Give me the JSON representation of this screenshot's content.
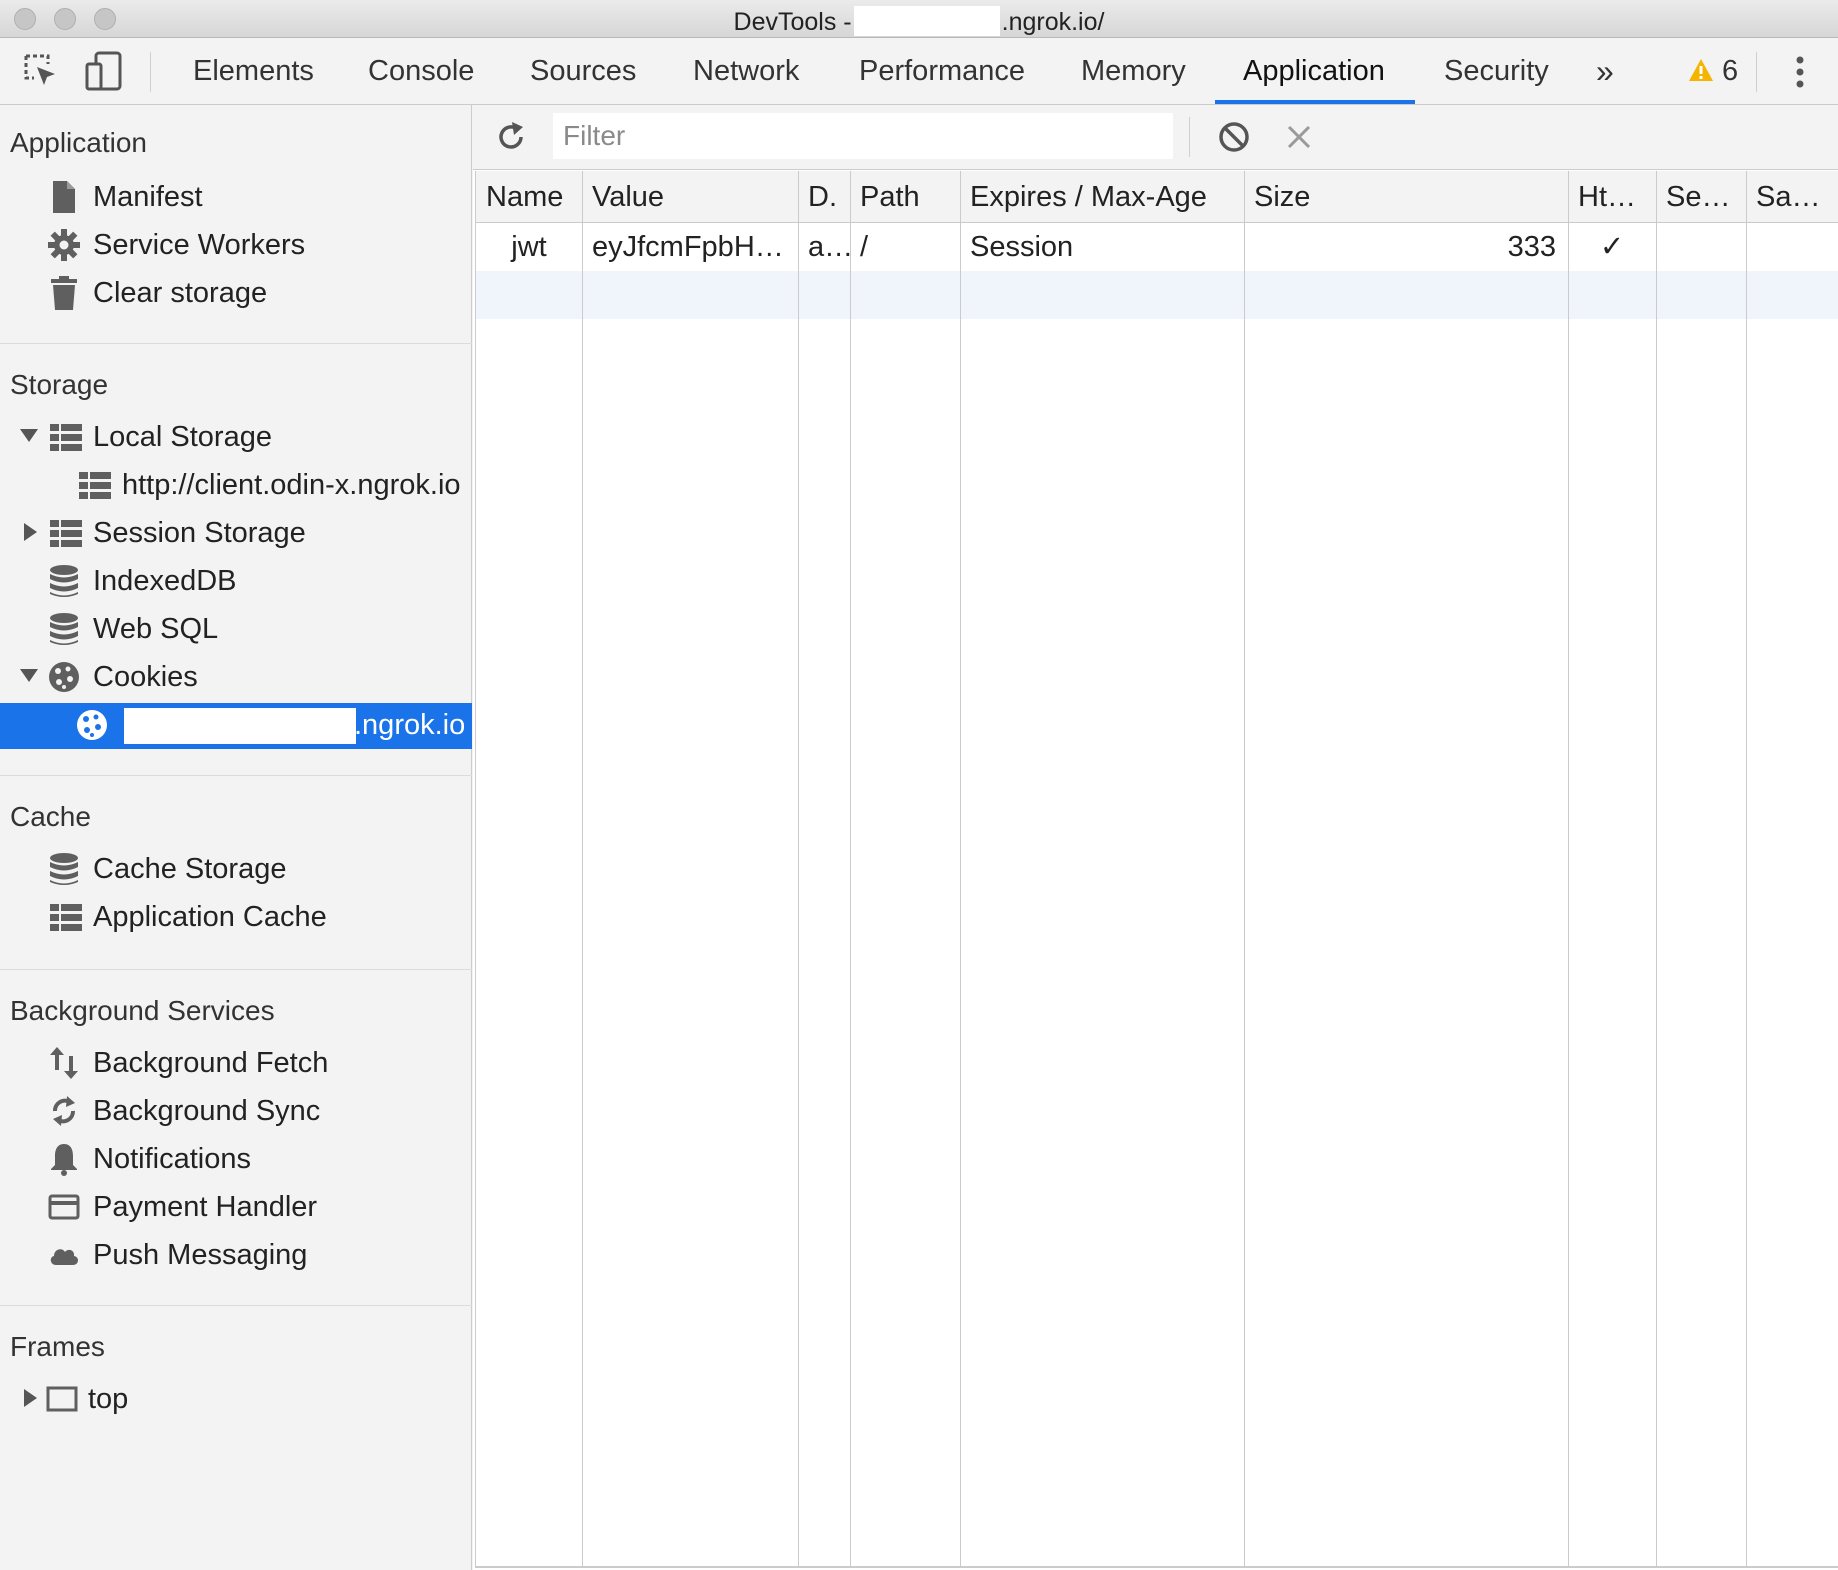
{
  "window": {
    "title_prefix": "DevTools -",
    "title_suffix": ".ngrok.io/"
  },
  "tabs": [
    {
      "label": "Elements"
    },
    {
      "label": "Console"
    },
    {
      "label": "Sources"
    },
    {
      "label": "Network"
    },
    {
      "label": "Performance"
    },
    {
      "label": "Memory"
    },
    {
      "label": "Application",
      "active": true
    },
    {
      "label": "Security"
    }
  ],
  "toolbar": {
    "more_tabs": "»",
    "warning_count": "6",
    "accent": "#1a73e8",
    "warning_color": "#f4b400"
  },
  "sidebar": {
    "sections": {
      "application": "Application",
      "storage": "Storage",
      "cache": "Cache",
      "background_services": "Background Services",
      "frames": "Frames"
    },
    "application_items": [
      "Manifest",
      "Service Workers",
      "Clear storage"
    ],
    "storage_items": {
      "local_storage": "Local Storage",
      "local_storage_child": "http://client.odin-x.ngrok.io",
      "session_storage": "Session Storage",
      "indexeddb": "IndexedDB",
      "web_sql": "Web SQL",
      "cookies": "Cookies",
      "cookies_child_suffix": ".ngrok.io"
    },
    "cache_items": [
      "Cache Storage",
      "Application Cache"
    ],
    "background_items": [
      "Background Fetch",
      "Background Sync",
      "Notifications",
      "Payment Handler",
      "Push Messaging"
    ],
    "frames_items": [
      "top"
    ]
  },
  "filter": {
    "placeholder": "Filter"
  },
  "table": {
    "columns": [
      "Name",
      "Value",
      "D.",
      "Path",
      "Expires / Max-Age",
      "Size",
      "Ht…",
      "Se…",
      "Sa…"
    ],
    "rows": [
      {
        "name": "jwt",
        "value": "eyJfcmFpbH…",
        "domain": "a…",
        "path": "/",
        "expires": "Session",
        "size": "333",
        "httponly": "✓",
        "secure": "",
        "samesite": ""
      }
    ]
  }
}
